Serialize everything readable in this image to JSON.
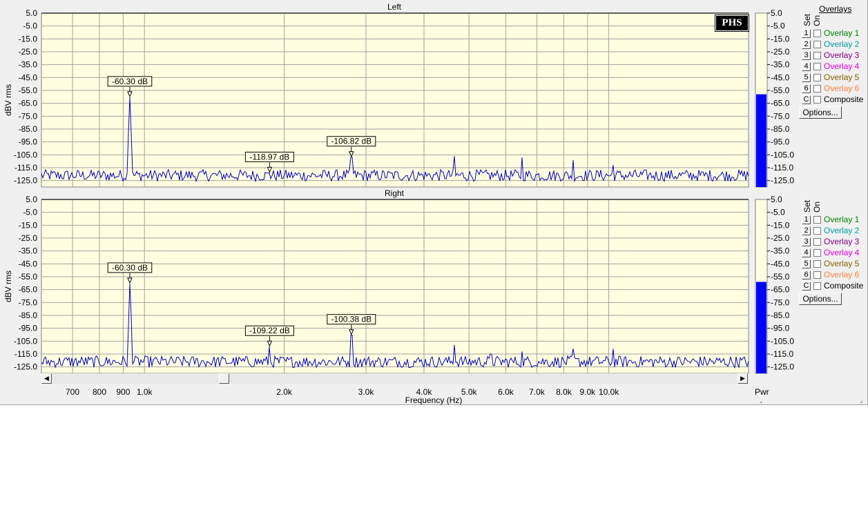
{
  "colors": {
    "plot_bg": "#fffee0",
    "trace": "#0000c0",
    "grid": "#a0a0a0",
    "bar": "#0000ff"
  },
  "chart_data": [
    {
      "type": "line",
      "title": "Left",
      "xlabel": "Frequency (Hz)",
      "ylabel": "dBV rms",
      "xscale": "log",
      "xlim": [
        600,
        20000
      ],
      "ylim": [
        -130,
        5
      ],
      "yticks": [
        "5.0",
        "-5.0",
        "-15.0",
        "-25.0",
        "-35.0",
        "-45.0",
        "-55.0",
        "-65.0",
        "-75.0",
        "-85.0",
        "-95.0",
        "-105.0",
        "-115.0",
        "-125.0"
      ],
      "noise_floor": -121,
      "peaks": [
        {
          "x": 930,
          "y": -60.3
        },
        {
          "x": 1860,
          "y": -118.97
        },
        {
          "x": 2790,
          "y": -106.82
        },
        {
          "x": 4650,
          "y": -106
        },
        {
          "x": 6510,
          "y": -107
        },
        {
          "x": 8370,
          "y": -109
        },
        {
          "x": 10230,
          "y": -113
        }
      ],
      "markers": [
        {
          "label": "-60.30 dB",
          "x": 930,
          "y": -60.3
        },
        {
          "label": "-118.97 dB",
          "x": 1860,
          "y": -118.97
        },
        {
          "label": "-106.82 dB",
          "x": 2790,
          "y": -106.82
        }
      ],
      "grid": true
    },
    {
      "type": "line",
      "title": "Right",
      "xlabel": "Frequency (Hz)",
      "ylabel": "dBV rms",
      "xscale": "log",
      "xlim": [
        600,
        20000
      ],
      "ylim": [
        -130,
        5
      ],
      "yticks": [
        "5.0",
        "-5.0",
        "-15.0",
        "-25.0",
        "-35.0",
        "-45.0",
        "-55.0",
        "-65.0",
        "-75.0",
        "-85.0",
        "-95.0",
        "-105.0",
        "-115.0",
        "-125.0"
      ],
      "noise_floor": -121,
      "peaks": [
        {
          "x": 930,
          "y": -60.3
        },
        {
          "x": 1860,
          "y": -109.22
        },
        {
          "x": 2790,
          "y": -100.38
        },
        {
          "x": 4650,
          "y": -108
        },
        {
          "x": 5580,
          "y": -115
        },
        {
          "x": 6510,
          "y": -113
        },
        {
          "x": 8370,
          "y": -111
        },
        {
          "x": 10230,
          "y": -111
        }
      ],
      "markers": [
        {
          "label": "-60.30 dB",
          "x": 930,
          "y": -60.3
        },
        {
          "label": "-109.22 dB",
          "x": 1860,
          "y": -109.22
        },
        {
          "label": "-100.38 dB",
          "x": 2790,
          "y": -100.38
        }
      ],
      "grid": true
    }
  ],
  "x_tick_labels": [
    {
      "x": 700,
      "label": "700"
    },
    {
      "x": 800,
      "label": "800"
    },
    {
      "x": 900,
      "label": "900"
    },
    {
      "x": 1000,
      "label": "1.0k"
    },
    {
      "x": 2000,
      "label": "2.0k"
    },
    {
      "x": 3000,
      "label": "3.0k"
    },
    {
      "x": 4000,
      "label": "4.0k"
    },
    {
      "x": 5000,
      "label": "5.0k"
    },
    {
      "x": 6000,
      "label": "6.0k"
    },
    {
      "x": 7000,
      "label": "7.0k"
    },
    {
      "x": 8000,
      "label": "8.0k"
    },
    {
      "x": 9000,
      "label": "9.0k"
    },
    {
      "x": 10000,
      "label": "10.0k"
    }
  ],
  "pwr_meter": {
    "label": "Pwr",
    "ticks": [
      "5.0",
      "-5.0",
      "-15.0",
      "-25.0",
      "-35.0",
      "-45.0",
      "-55.0",
      "-65.0",
      "-75.0",
      "-85.0",
      "-95.0",
      "-105.0",
      "-115.0",
      "-125.0"
    ],
    "levels": [
      -58,
      -59
    ]
  },
  "logo": "PHS",
  "overlays": {
    "header": "Overlays",
    "set_label": "Set",
    "on_label": "On",
    "options_label": "Options...",
    "items": [
      {
        "key": "1",
        "label": "Overlay 1",
        "color": "#008000"
      },
      {
        "key": "2",
        "label": "Overlay 2",
        "color": "#00a0a0"
      },
      {
        "key": "3",
        "label": "Overlay 3",
        "color": "#800080"
      },
      {
        "key": "4",
        "label": "Overlay 4",
        "color": "#e000e0"
      },
      {
        "key": "5",
        "label": "Overlay 5",
        "color": "#806000"
      },
      {
        "key": "6",
        "label": "Overlay 6",
        "color": "#ff8040"
      },
      {
        "key": "C",
        "label": "Composite",
        "color": "#000000"
      }
    ]
  },
  "scrollbar": {
    "left_arrow": "◀",
    "right_arrow": "▶"
  }
}
